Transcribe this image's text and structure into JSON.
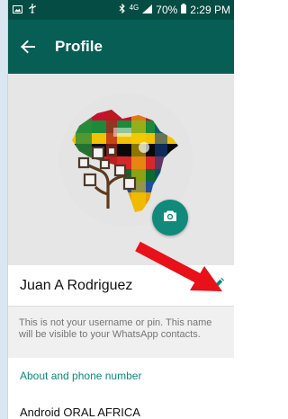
{
  "status_bar": {
    "net_type": "4G",
    "battery": "70%",
    "time": "2:29 PM"
  },
  "app_bar": {
    "title": "Profile"
  },
  "profile": {
    "name": "Juan A Rodriguez",
    "name_hint": "This is not your username or pin. This name will be visible to your WhatsApp contacts."
  },
  "about": {
    "header": "About and phone number",
    "value": "Android ORAL AFRICA"
  },
  "colors": {
    "app_bar": "#075e54",
    "status_bar": "#054d44",
    "accent": "#0f8a7b",
    "annotation_arrow": "#e8111a"
  }
}
